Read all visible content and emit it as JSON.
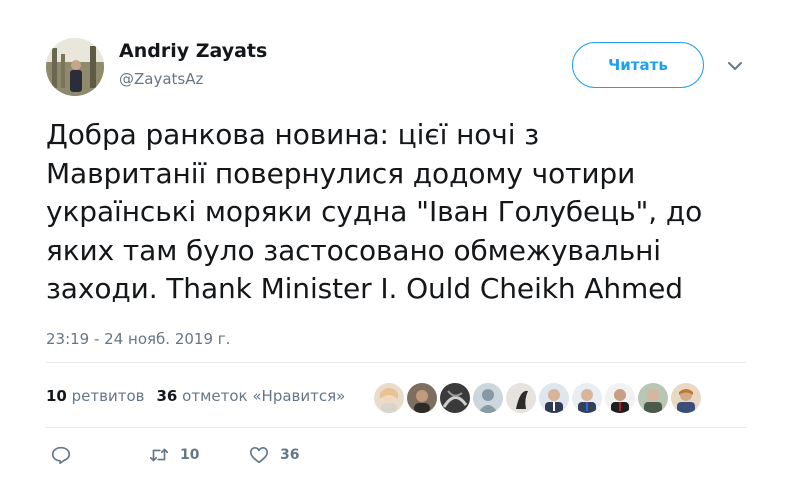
{
  "author": {
    "name": "Andriy Zayats",
    "handle": "@ZayatsAz"
  },
  "follow_button": {
    "label": "Читать"
  },
  "tweet": {
    "lines": [
      "Добра ранкова новина: цієї ночі з",
      "Мавританії повернулися додому чотири",
      "українські моряки судна \"Іван Голубець\", до",
      "яких там було застосовано обмежувальні",
      "заходи. Thank Minister I. Ould Cheikh Ahmed"
    ],
    "timestamp": "23:19 - 24 нояб. 2019 г."
  },
  "stats": {
    "retweets_count": "10",
    "retweets_label": "ретвитов",
    "likes_count": "36",
    "likes_label": "отметок «Нравится»"
  },
  "facepile_count": 10,
  "actions": {
    "reply_icon": "reply-icon",
    "retweet_icon": "retweet-icon",
    "retweet_count": "10",
    "like_icon": "heart-icon",
    "like_count": "36"
  },
  "colors": {
    "accent": "#1da1f2",
    "text": "#14171a",
    "secondary": "#657786",
    "divider": "#e6ecf0"
  }
}
